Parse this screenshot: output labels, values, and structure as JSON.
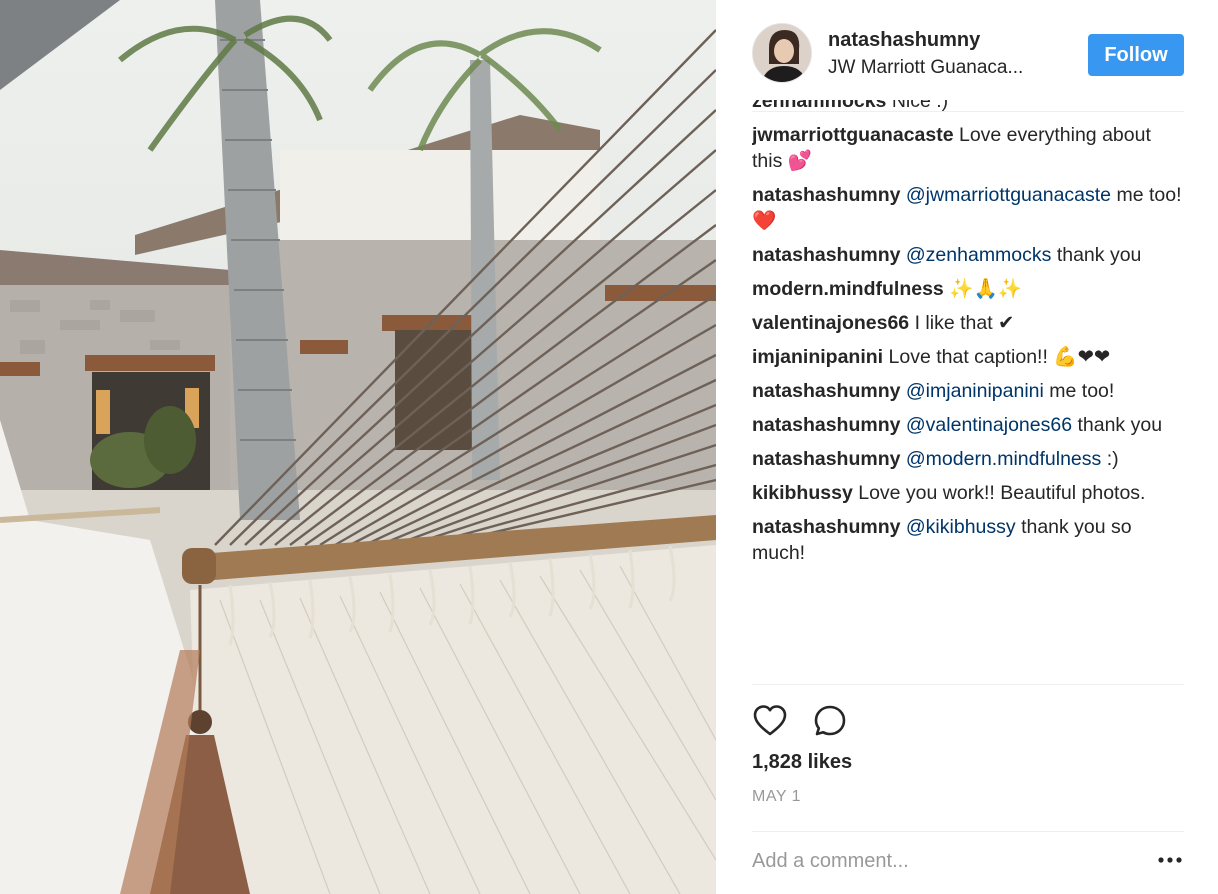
{
  "post": {
    "username": "natashashumny",
    "location": "JW Marriott Guanaca...",
    "follow_label": "Follow",
    "likes": "1,828 likes",
    "date": "MAY 1",
    "add_comment_placeholder": "Add a comment..."
  },
  "comments": [
    {
      "user": "zenhammocks",
      "pre": "",
      "mention": "",
      "text": "Nice :)"
    },
    {
      "user": "jwmarriottguanacaste",
      "pre": "",
      "mention": "",
      "text": "Love everything about this 💕"
    },
    {
      "user": "natashashumny",
      "pre": "",
      "mention": "@jwmarriottguanacaste",
      "text": "me too! ❤️"
    },
    {
      "user": "natashashumny",
      "pre": "",
      "mention": "@zenhammocks",
      "text": "thank you"
    },
    {
      "user": "modern.mindfulness",
      "pre": "",
      "mention": "",
      "text": "✨🙏✨"
    },
    {
      "user": "valentinajones66",
      "pre": "",
      "mention": "",
      "text": "I like that ✔"
    },
    {
      "user": "imjaninipanini",
      "pre": "",
      "mention": "",
      "text": "Love that caption!! 💪❤❤"
    },
    {
      "user": "natashashumny",
      "pre": "",
      "mention": "@imjaninipanini",
      "text": "me too!"
    },
    {
      "user": "natashashumny",
      "pre": "",
      "mention": "@valentinajones66",
      "text": "thank you"
    },
    {
      "user": "natashashumny",
      "pre": "",
      "mention": "@modern.mindfulness",
      "text": ":)"
    },
    {
      "user": "kikibhussy",
      "pre": "",
      "mention": "",
      "text": "Love you work!! Beautiful photos."
    },
    {
      "user": "natashashumny",
      "pre": "",
      "mention": "@kikibhussy",
      "text": "thank you so much!"
    }
  ],
  "icons": {
    "like": "heart-icon",
    "comment": "comment-bubble-icon",
    "more": "more-options-icon"
  },
  "colors": {
    "follow_button": "#3897f0",
    "mention": "#003569",
    "muted": "#999999"
  }
}
